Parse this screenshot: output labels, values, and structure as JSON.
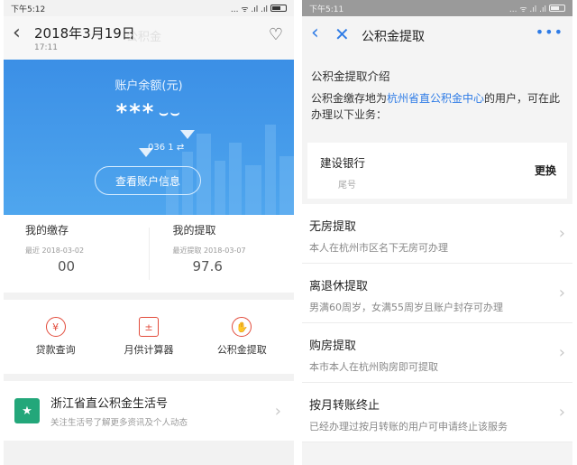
{
  "left": {
    "status": {
      "time": "下午5:12",
      "signal": "... ᯤ .ıl .ıl"
    },
    "header": {
      "date": "2018年3月19日",
      "time": "17:11",
      "ghost": "公积金"
    },
    "card": {
      "balance_label": "账户余额(元)",
      "balance_masked": "***",
      "eye": "⌣⌣",
      "account_partial": "036 1",
      "swap": "⇄",
      "view_button": "查看账户信息"
    },
    "stats": [
      {
        "title": "我的缴存",
        "date": "最近 2018-03-02",
        "value": "00"
      },
      {
        "title": "我的提取",
        "date": "最近提取 2018-03-07",
        "value": "97.6"
      }
    ],
    "tools": [
      {
        "label": "贷款查询",
        "icon": "¥"
      },
      {
        "label": "月供计算器",
        "icon": "±"
      },
      {
        "label": "公积金提取",
        "icon": "✋"
      }
    ],
    "life": {
      "title": "浙江省直公积金生活号",
      "subtitle": "关注生活号了解更多资讯及个人动态",
      "icon": "★"
    }
  },
  "right": {
    "status": {
      "time": "下午5:11",
      "signal": "... ᯤ .ıl .ıl"
    },
    "header": {
      "title": "公积金提取",
      "dots": "•••"
    },
    "intro": {
      "title": "公积金提取介绍",
      "text_before": "公积金缴存地为",
      "text_highlight": "杭州省直公积金中心",
      "text_after": "的用户，可在此办理以下业务："
    },
    "bank": {
      "name": "建设银行",
      "number": "尾号",
      "change": "更换"
    },
    "menu": [
      {
        "title": "无房提取",
        "desc": "本人在杭州市区名下无房可办理"
      },
      {
        "title": "离退休提取",
        "desc": "男满60周岁，女满55周岁且账户封存可办理"
      },
      {
        "title": "购房提取",
        "desc": "本市本人在杭州购房即可提取"
      },
      {
        "title": "按月转账终止",
        "desc": "已经办理过按月转账的用户可申请终止该服务"
      }
    ]
  },
  "colors": {
    "accent_blue": "#2f7ce6",
    "card_blue": "#3b8fe6",
    "tool_red": "#e24b3b",
    "life_green": "#23a77a"
  }
}
